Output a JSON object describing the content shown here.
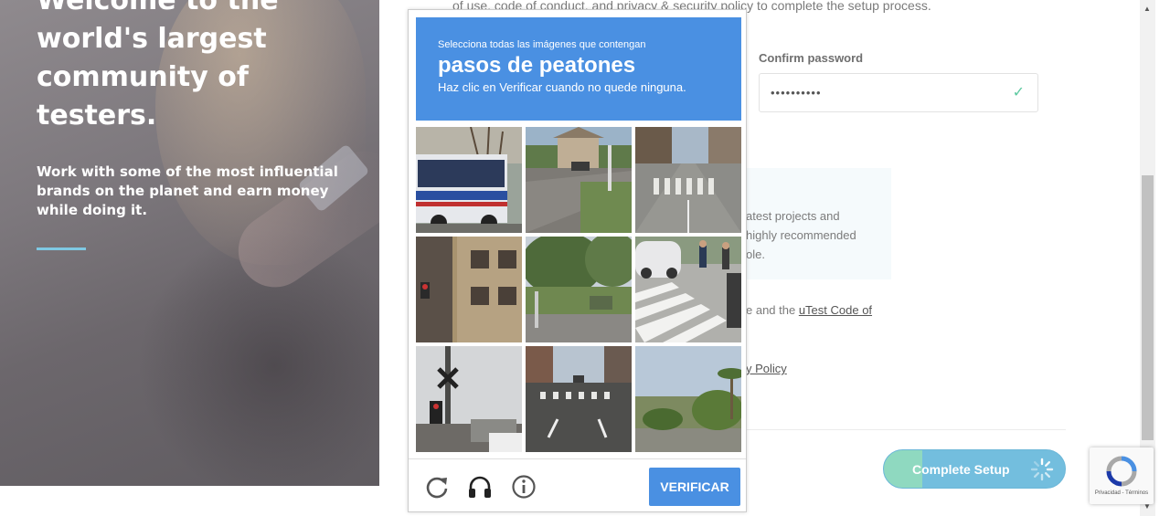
{
  "hero": {
    "title_lines": [
      "Welcome to the",
      "world's largest",
      "community of",
      "testers."
    ],
    "subtitle": "Work with some of the most influential brands on the planet and earn money while doing it."
  },
  "form": {
    "terms_text": "of use, code of conduct, and privacy & security policy to complete the setup process.",
    "confirm_label": "Confirm password",
    "confirm_value": "••••••••••",
    "info_lines": [
      "atest projects and",
      "highly recommended",
      "ole."
    ],
    "agree_prefix": "e and the ",
    "agree_link": "uTest Code of",
    "privacy_link": "y Policy",
    "complete_button": "Complete Setup"
  },
  "captcha": {
    "instruction": "Selecciona todas las imágenes que contengan",
    "target": "pasos de peatones",
    "hint": "Haz clic en Verificar cuando no quede ninguna.",
    "verify_button": "VERIFICAR",
    "icons": [
      "reload-icon",
      "audio-icon",
      "info-icon"
    ],
    "tiles": [
      "bus",
      "street-corner",
      "road-crossing",
      "building",
      "street-trees",
      "crosswalk-pedestrians",
      "traffic-signal",
      "city-street-crosswalk",
      "palm-trees"
    ]
  },
  "recaptcha_badge": {
    "text": "Privacidad - Términos"
  },
  "colors": {
    "captcha_blue": "#4a90e2",
    "accent_teal": "#8fd9c0",
    "button_blue": "#73bede"
  }
}
